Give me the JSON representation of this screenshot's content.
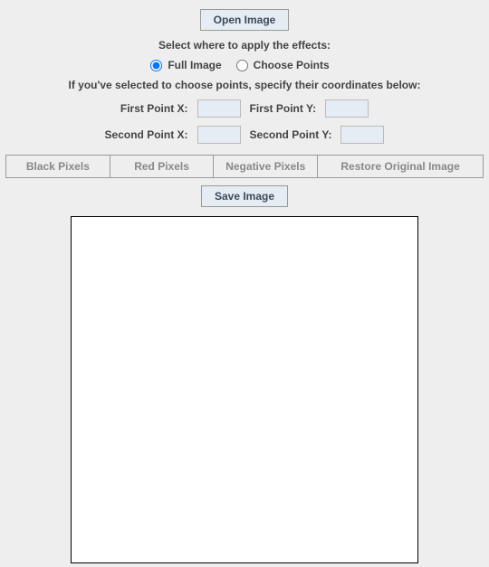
{
  "buttons": {
    "open_image": "Open Image",
    "save_image": "Save Image"
  },
  "instructions": {
    "apply_where": "Select where to apply the effects:",
    "specify_coords": "If you've selected to choose points, specify their coordinates below:"
  },
  "radios": {
    "full_image": "Full Image",
    "choose_points": "Choose Points",
    "selected": "full_image"
  },
  "coords": {
    "first_x_label": "First Point X:",
    "first_y_label": "First Point Y:",
    "second_x_label": "Second Point X:",
    "second_y_label": "Second Point Y:",
    "first_x": "",
    "first_y": "",
    "second_x": "",
    "second_y": ""
  },
  "effects": {
    "black_pixels": "Black Pixels",
    "red_pixels": "Red Pixels",
    "negative_pixels": "Negative Pixels",
    "restore_original": "Restore Original Image"
  }
}
